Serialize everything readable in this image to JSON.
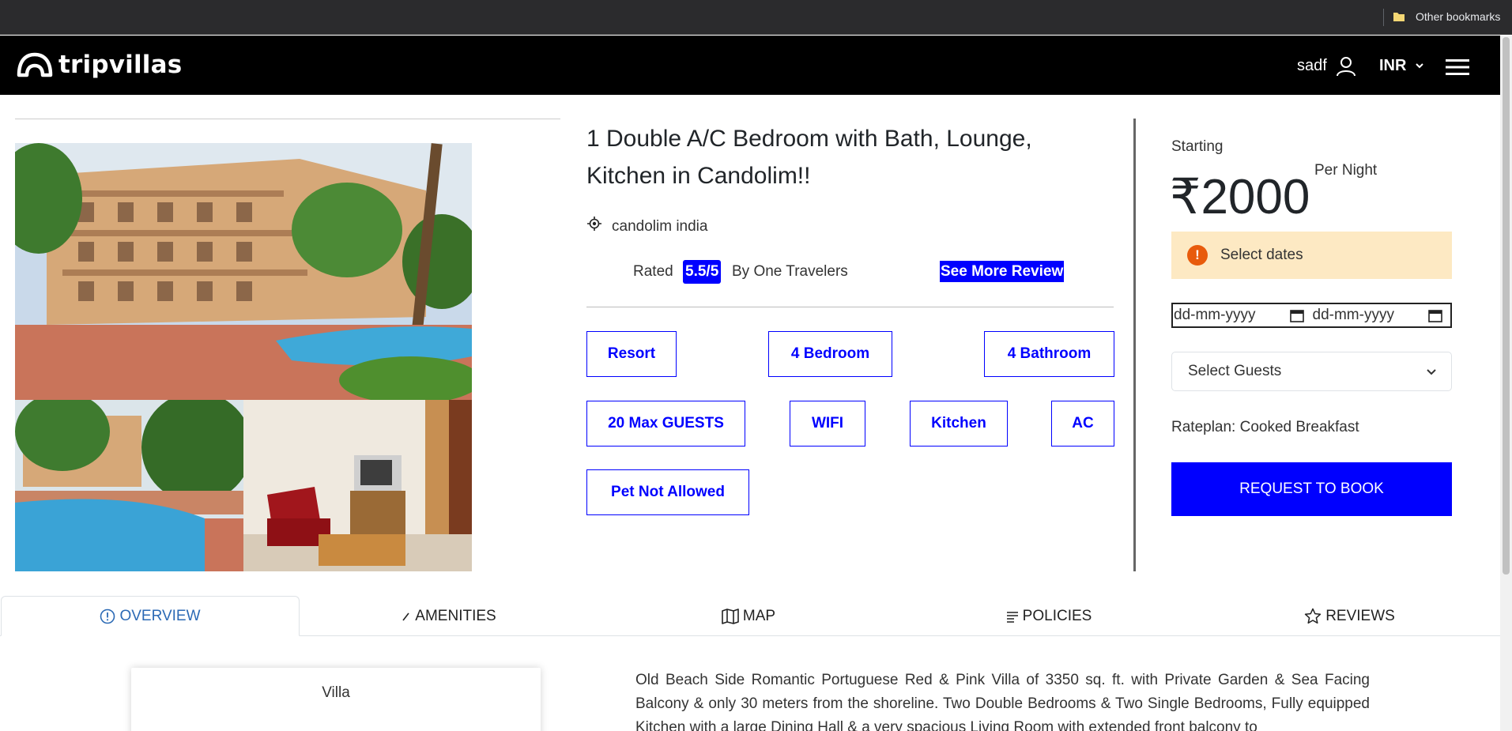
{
  "browser": {
    "bookmark_folder": "Other bookmarks"
  },
  "navbar": {
    "brand": "tripvillas",
    "user_name": "sadf",
    "currency": "INR"
  },
  "property": {
    "title": "1 Double A/C Bedroom with Bath, Lounge, Kitchen in Candolim!!",
    "location": "candolim india",
    "rated_label": "Rated",
    "rating": "5.5/5",
    "rating_by": "By One Travelers",
    "see_more_review": "See More Review",
    "tags": [
      "Resort",
      "4 Bedroom",
      "4 Bathroom",
      "20 Max GUESTS",
      "WIFI",
      "Kitchen",
      "AC",
      "Pet Not Allowed"
    ]
  },
  "booking": {
    "starting_label": "Starting",
    "price": "₹2000",
    "per_night": "Per Night",
    "alert_icon": "!",
    "alert_text": "Select dates",
    "date_from_placeholder": "dd-mm-yyyy",
    "date_to_placeholder": "dd-mm-yyyy",
    "guests_placeholder": "Select Guests",
    "rateplan": "Rateplan: Cooked Breakfast",
    "request_button": "REQUEST TO BOOK"
  },
  "tabs": [
    {
      "label": "OVERVIEW",
      "icon": "info-circle-icon",
      "active": true
    },
    {
      "label": "AMENITIES",
      "icon": "pencil-icon",
      "active": false
    },
    {
      "label": "MAP",
      "icon": "map-icon",
      "active": false
    },
    {
      "label": "POLICIES",
      "icon": "list-icon",
      "active": false
    },
    {
      "label": "REVIEWS",
      "icon": "star-icon",
      "active": false
    }
  ],
  "overview": {
    "property_type": "Villa",
    "description": "Old Beach Side Romantic Portuguese Red & Pink Villa of 3350 sq. ft. with Private Garden & Sea Facing Balcony & only 30 meters from the shoreline. Two Double Bedrooms & Two Single Bedrooms, Fully equipped Kitchen with a large Dining Hall & a very spacious Living Room with extended front balcony to"
  },
  "colors": {
    "accent": "#0000ff",
    "navbar": "#000000",
    "alert_bg": "#fde9c3",
    "alert_icon": "#e85b0c",
    "active_tab": "#2c6ab5"
  }
}
